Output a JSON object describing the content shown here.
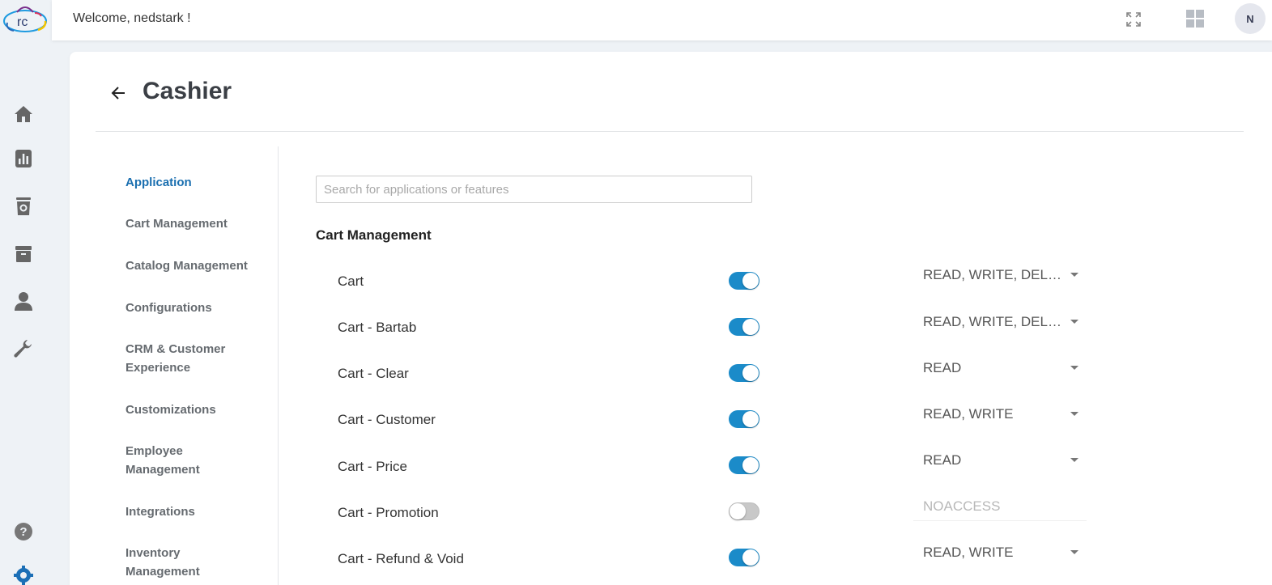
{
  "header": {
    "welcome": "Welcome, nedstark !",
    "avatar_initial": "N",
    "logo_text": "rc"
  },
  "page": {
    "title": "Cashier"
  },
  "sidebar_nav": [
    {
      "label": "Application",
      "active": true
    },
    {
      "label": "Cart Management"
    },
    {
      "label": "Catalog Management"
    },
    {
      "label": "Configurations"
    },
    {
      "label": "CRM & Customer Experience"
    },
    {
      "label": "Customizations"
    },
    {
      "label": "Employee Management"
    },
    {
      "label": "Integrations"
    },
    {
      "label": "Inventory Management"
    }
  ],
  "search": {
    "placeholder": "Search for applications or features",
    "value": ""
  },
  "section": {
    "title": "Cart Management"
  },
  "features": [
    {
      "label": "Cart",
      "enabled": true,
      "permission": "READ, WRITE, DELE..."
    },
    {
      "label": "Cart - Bartab",
      "enabled": true,
      "permission": "READ, WRITE, DELE..."
    },
    {
      "label": "Cart - Clear",
      "enabled": true,
      "permission": "READ"
    },
    {
      "label": "Cart - Customer",
      "enabled": true,
      "permission": "READ, WRITE"
    },
    {
      "label": "Cart - Price",
      "enabled": true,
      "permission": "READ"
    },
    {
      "label": "Cart - Promotion",
      "enabled": false,
      "permission": "NOACCESS"
    },
    {
      "label": "Cart - Refund & Void",
      "enabled": true,
      "permission": "READ, WRITE"
    }
  ],
  "colors": {
    "accent": "#1b8bc9",
    "active_nav": "#1a6fb0",
    "toggle_off": "#c8c8c8",
    "rail_bg": "#eef2f6"
  },
  "icons": {
    "rail": [
      "home-icon",
      "chart-icon",
      "bin-icon",
      "archive-icon",
      "user-icon",
      "wrench-icon",
      "help-icon",
      "settings-icon"
    ],
    "top": [
      "fullscreen-icon",
      "grid-icon"
    ]
  }
}
